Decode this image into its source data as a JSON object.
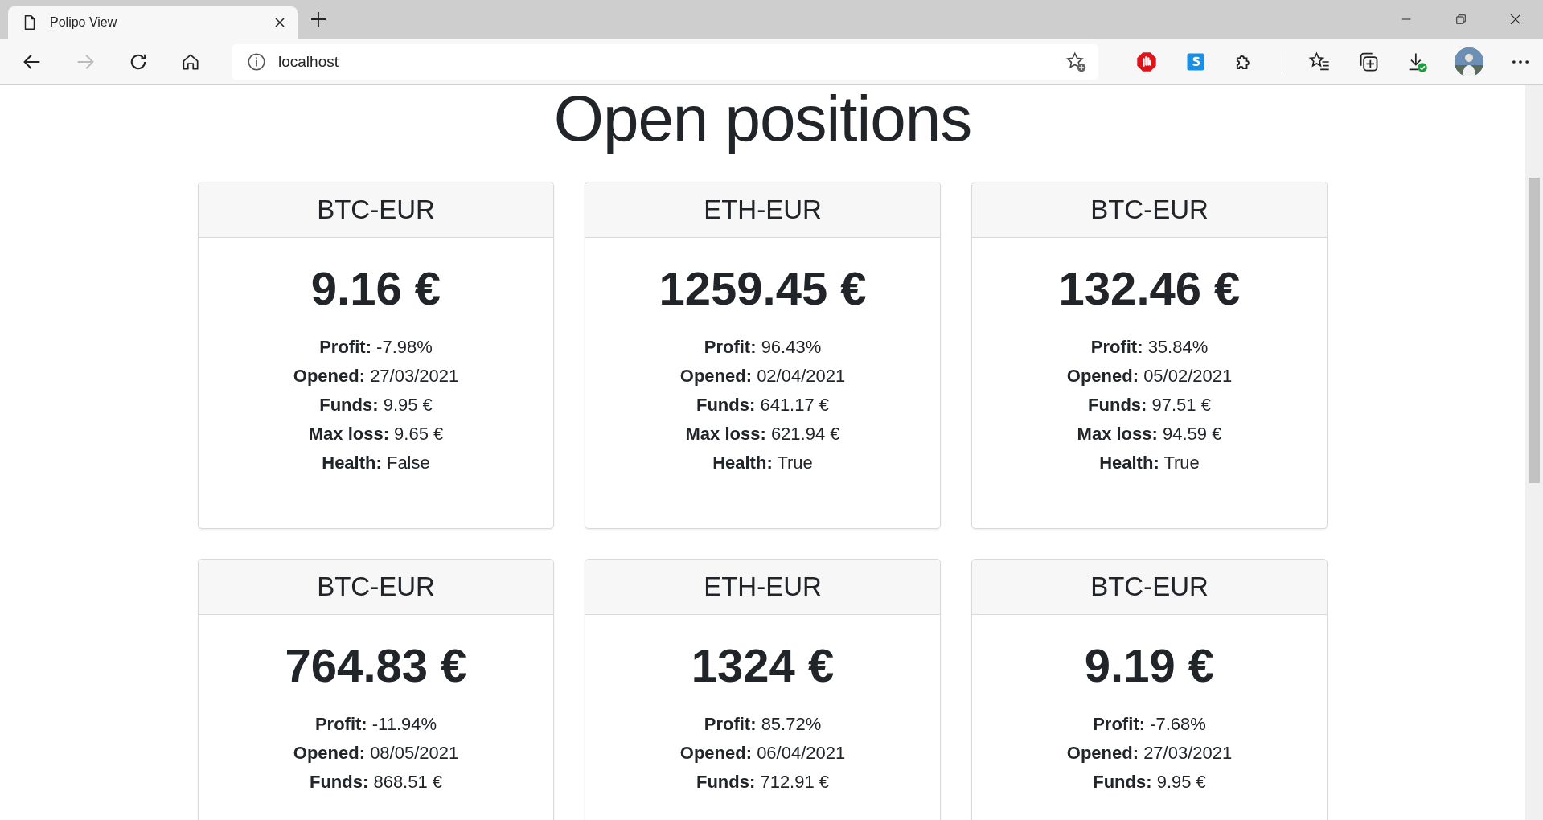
{
  "browser": {
    "tab_title": "Polipo View",
    "url": "localhost"
  },
  "page": {
    "title": "Open positions",
    "cards": [
      {
        "pair": "BTC-EUR",
        "price": "9.16 €",
        "details": [
          {
            "label": "Profit:",
            "value": "-7.98%"
          },
          {
            "label": "Opened:",
            "value": "27/03/2021"
          },
          {
            "label": "Funds:",
            "value": "9.95 €"
          },
          {
            "label": "Max loss:",
            "value": "9.65 €"
          },
          {
            "label": "Health:",
            "value": "False"
          }
        ]
      },
      {
        "pair": "ETH-EUR",
        "price": "1259.45 €",
        "details": [
          {
            "label": "Profit:",
            "value": "96.43%"
          },
          {
            "label": "Opened:",
            "value": "02/04/2021"
          },
          {
            "label": "Funds:",
            "value": "641.17 €"
          },
          {
            "label": "Max loss:",
            "value": "621.94 €"
          },
          {
            "label": "Health:",
            "value": "True"
          }
        ]
      },
      {
        "pair": "BTC-EUR",
        "price": "132.46 €",
        "details": [
          {
            "label": "Profit:",
            "value": "35.84%"
          },
          {
            "label": "Opened:",
            "value": "05/02/2021"
          },
          {
            "label": "Funds:",
            "value": "97.51 €"
          },
          {
            "label": "Max loss:",
            "value": "94.59 €"
          },
          {
            "label": "Health:",
            "value": "True"
          }
        ]
      },
      {
        "pair": "BTC-EUR",
        "price": "764.83 €",
        "details": [
          {
            "label": "Profit:",
            "value": "-11.94%"
          },
          {
            "label": "Opened:",
            "value": "08/05/2021"
          },
          {
            "label": "Funds:",
            "value": "868.51 €"
          }
        ]
      },
      {
        "pair": "ETH-EUR",
        "price": "1324 €",
        "details": [
          {
            "label": "Profit:",
            "value": "85.72%"
          },
          {
            "label": "Opened:",
            "value": "06/04/2021"
          },
          {
            "label": "Funds:",
            "value": "712.91 €"
          }
        ]
      },
      {
        "pair": "BTC-EUR",
        "price": "9.19 €",
        "details": [
          {
            "label": "Profit:",
            "value": "-7.68%"
          },
          {
            "label": "Opened:",
            "value": "27/03/2021"
          },
          {
            "label": "Funds:",
            "value": "9.95 €"
          }
        ]
      }
    ]
  }
}
